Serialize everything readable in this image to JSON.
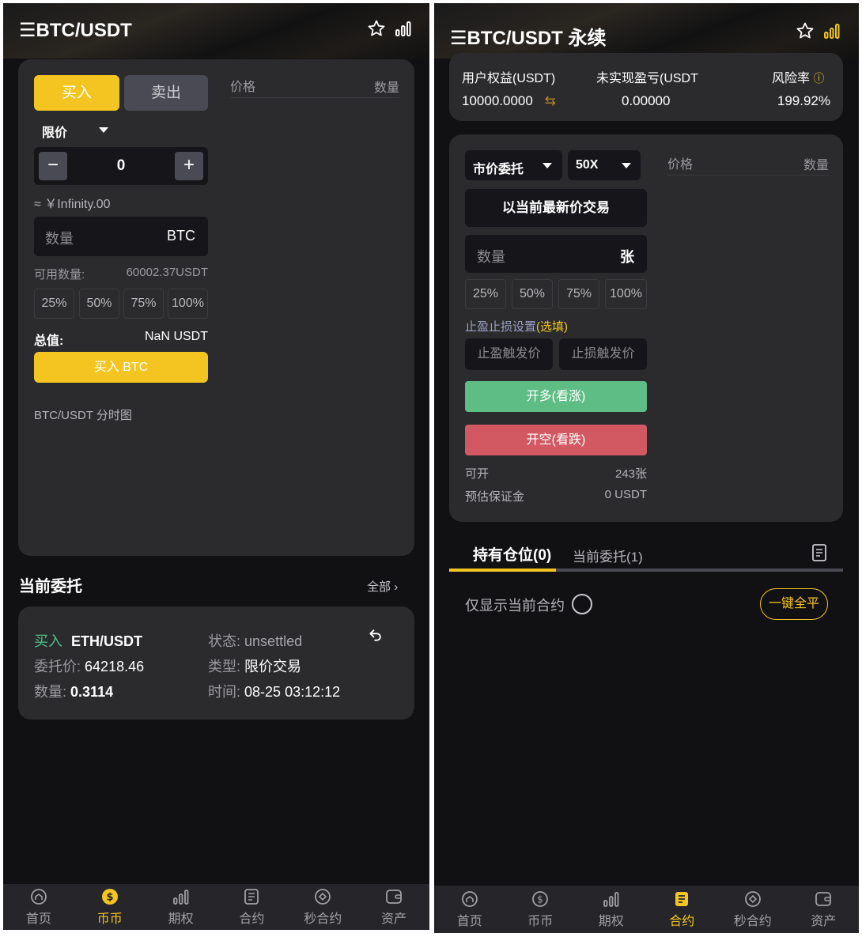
{
  "left": {
    "header": {
      "title": "BTC/USDT"
    },
    "trade": {
      "buy_tab": "买入",
      "sell_tab": "卖出",
      "order_type": "限价",
      "price_value": "0",
      "approx": "≈ ￥Infinity.00",
      "amount_placeholder": "数量",
      "amount_unit": "BTC",
      "available_label": "可用数量:",
      "available_value": "60002.37USDT",
      "percents": [
        "25%",
        "50%",
        "75%",
        "100%"
      ],
      "total_label": "总值:",
      "total_value": "NaN USDT",
      "submit": "买入 BTC",
      "chart_label": "BTC/USDT 分时图"
    },
    "orderbook": {
      "price": "价格",
      "amount": "数量"
    },
    "orders": {
      "title": "当前委托",
      "all": "全部",
      "item": {
        "side": "买入",
        "pair": "ETH/USDT",
        "status_label": "状态:",
        "status_value": "unsettled",
        "price_label": "委托价:",
        "price_value": "64218.46",
        "type_label": "类型:",
        "type_value": "限价交易",
        "qty_label": "数量:",
        "qty_value": "0.3114",
        "time_label": "时间:",
        "time_value": "08-25 03:12:12"
      }
    }
  },
  "right": {
    "header": {
      "title": "BTC/USDT 永续"
    },
    "summary": {
      "equity_label": "用户权益(USDT)",
      "pnl_label": "未实现盈亏(USDT",
      "risk_label": "风险率",
      "equity_value": "10000.0000",
      "pnl_value": "0.00000",
      "risk_value": "199.92%"
    },
    "trade": {
      "order_type": "市价委托",
      "leverage": "50X",
      "market_btn": "以当前最新价交易",
      "amount_placeholder": "数量",
      "amount_unit": "张",
      "percents": [
        "25%",
        "50%",
        "75%",
        "100%"
      ],
      "tpsl_label": "止盈止损设置",
      "tpsl_optional": "(选填)",
      "tp_placeholder": "止盈触发价",
      "sl_placeholder": "止损触发价",
      "long_btn": "开多(看涨)",
      "short_btn": "开空(看跌)",
      "can_open_label": "可开",
      "can_open_value": "243张",
      "margin_label": "预估保证金",
      "margin_value": "0 USDT"
    },
    "orderbook": {
      "price": "价格",
      "amount": "数量"
    },
    "positions": {
      "tab_positions": "持有仓位(0)",
      "tab_orders": "当前委托(1)",
      "only_current": "仅显示当前合约",
      "close_all": "一键全平"
    }
  },
  "tabbar": {
    "items": [
      "首页",
      "币币",
      "期权",
      "合约",
      "秒合约",
      "资产"
    ],
    "left_active": 1,
    "right_active": 3
  },
  "colors": {
    "accent": "#f4c520",
    "long": "#5dbd84",
    "short": "#d25962",
    "buy_text": "#4fc18a"
  }
}
